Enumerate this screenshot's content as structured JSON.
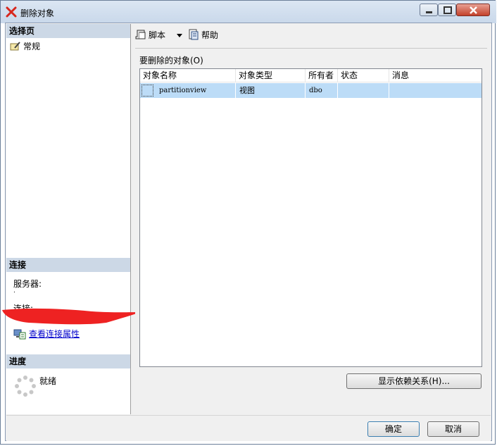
{
  "window": {
    "title": "删除对象"
  },
  "left_pane": {
    "select_page_header": "选择页",
    "pages": [
      {
        "label": "常规"
      }
    ],
    "connection_header": "连接",
    "server_label": "服务器:",
    "server_value": ".",
    "connection_label": "连接:",
    "view_connection_link": "查看连接属性",
    "progress_header": "进度",
    "progress_status": "就绪"
  },
  "toolbar": {
    "script_label": "脚本",
    "help_label": "帮助"
  },
  "objects_group": {
    "label": "要删除的对象(O)",
    "columns": [
      "对象名称",
      "对象类型",
      "所有者",
      "状态",
      "消息"
    ],
    "rows": [
      {
        "name": "partitionview",
        "type": "视图",
        "owner": "dbo",
        "status": "",
        "message": ""
      }
    ]
  },
  "buttons": {
    "show_dependencies": "显示依赖关系(H)...",
    "ok": "确定",
    "cancel": "取消"
  }
}
